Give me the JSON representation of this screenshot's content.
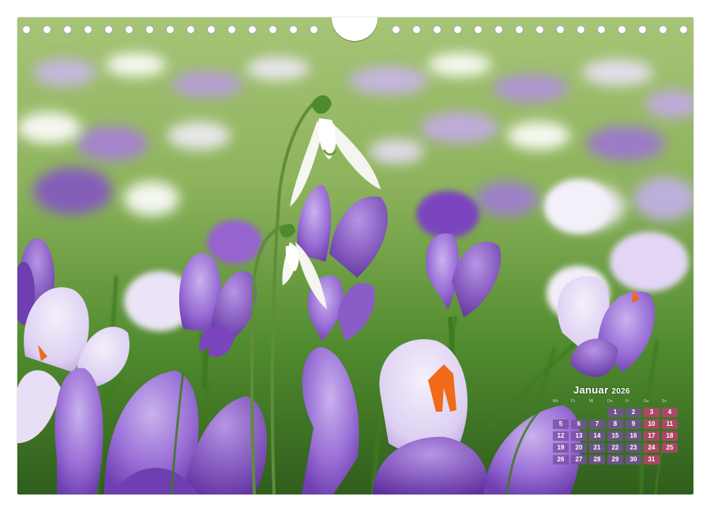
{
  "calendar": {
    "month": "Januar",
    "year": "2026",
    "weekdays": [
      "Mo",
      "Di",
      "Mi",
      "Do",
      "Fr",
      "Sa",
      "So"
    ],
    "weeks": [
      [
        "",
        "",
        "",
        "1",
        "2",
        "3",
        "4"
      ],
      [
        "5",
        "6",
        "7",
        "8",
        "9",
        "10",
        "11"
      ],
      [
        "12",
        "13",
        "14",
        "15",
        "16",
        "17",
        "18"
      ],
      [
        "19",
        "20",
        "21",
        "22",
        "23",
        "24",
        "25"
      ],
      [
        "26",
        "27",
        "28",
        "29",
        "30",
        "31",
        ""
      ]
    ]
  },
  "photo": {
    "subject": "crocus-and-snowdrop-meadow"
  },
  "colors": {
    "crocus_purple": "#8a5cc8",
    "crocus_light": "#c9b2ee",
    "stigma_orange": "#f06a1a",
    "grass_green": "#4f8a2e",
    "calendar_cell": "#78509f",
    "sunday_cell": "#c83c78"
  }
}
